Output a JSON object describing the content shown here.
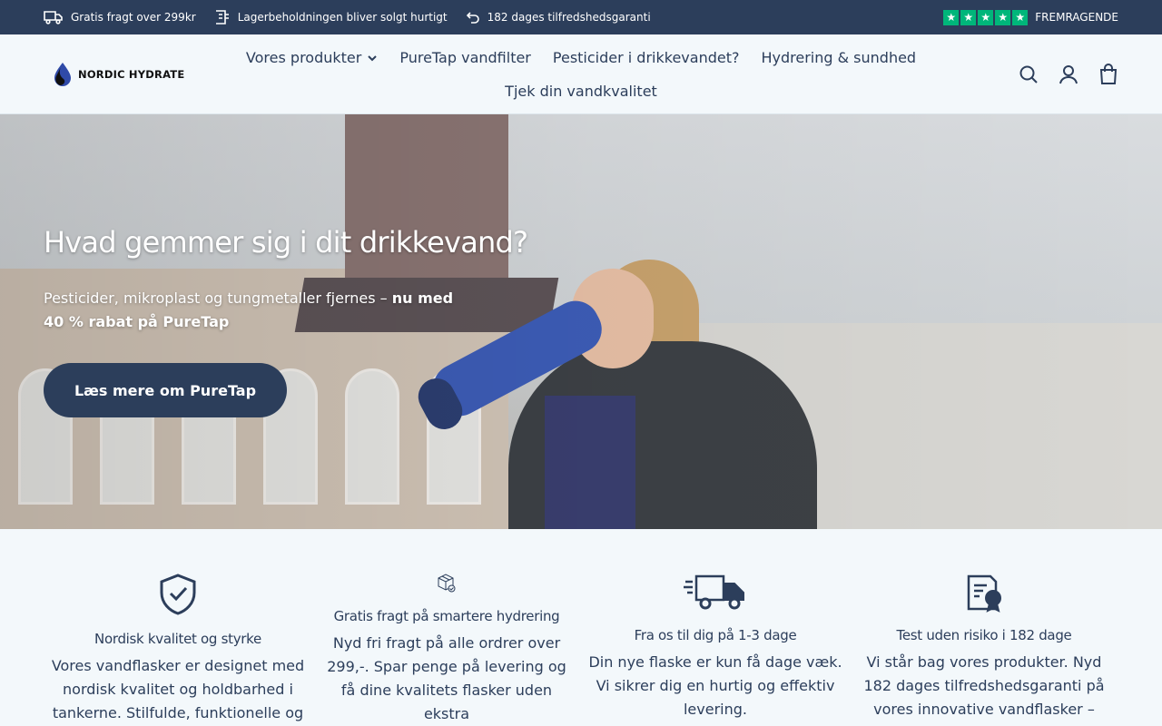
{
  "topbar": {
    "items": [
      {
        "icon": "truck-icon",
        "label": "Gratis fragt over 299kr"
      },
      {
        "icon": "box-icon",
        "label": "Lagerbeholdningen bliver solgt hurtigt"
      },
      {
        "icon": "return-icon",
        "label": "182 dages tilfredshedsgaranti"
      }
    ],
    "rating_label": "FREMRAGENDE",
    "rating_stars": 5,
    "star_color": "#00b67a"
  },
  "header": {
    "logo_text": "NORDIC HYDRATE",
    "nav": [
      {
        "label": "Vores produkter",
        "has_dropdown": true
      },
      {
        "label": "PureTap vandfilter"
      },
      {
        "label": "Pesticider i drikkevandet?"
      },
      {
        "label": "Hydrering & sundhed"
      },
      {
        "label": "Tjek din vandkvalitet"
      }
    ]
  },
  "hero": {
    "title": "Hvad gemmer sig i dit drikkevand?",
    "subtitle_plain": "Pesticider, mikroplast og tungmetaller fjernes – ",
    "subtitle_bold": "nu med 40 % rabat på PureTap",
    "button_label": "Læs mere om PureTap"
  },
  "features": [
    {
      "icon": "shield-check-icon",
      "title": "Nordisk kvalitet og styrke",
      "text": "Vores vandflasker er designet med nordisk kvalitet og holdbarhed i tankerne. Stilfulde, funktionelle og"
    },
    {
      "icon": "package-check-icon",
      "title": "Gratis fragt på smartere hydrering",
      "text": "Nyd fri fragt på alle ordrer over 299,-. Spar penge på levering og få dine kvalitets flasker uden ekstra"
    },
    {
      "icon": "delivery-truck-icon",
      "title": "Fra os til dig på 1-3 dage",
      "text": "Din nye flaske er kun få dage væk. Vi sikrer dig en hurtig og effektiv levering."
    },
    {
      "icon": "guarantee-document-icon",
      "title": "Test uden risiko i 182 dage",
      "text": "Vi står bag vores produkter. Nyd 182 dages tilfredshedsgaranti på vores innovative vandflasker –"
    }
  ],
  "colors": {
    "primary": "#2c3e5b",
    "background": "#f3f8fb",
    "trustpilot": "#00b67a"
  }
}
